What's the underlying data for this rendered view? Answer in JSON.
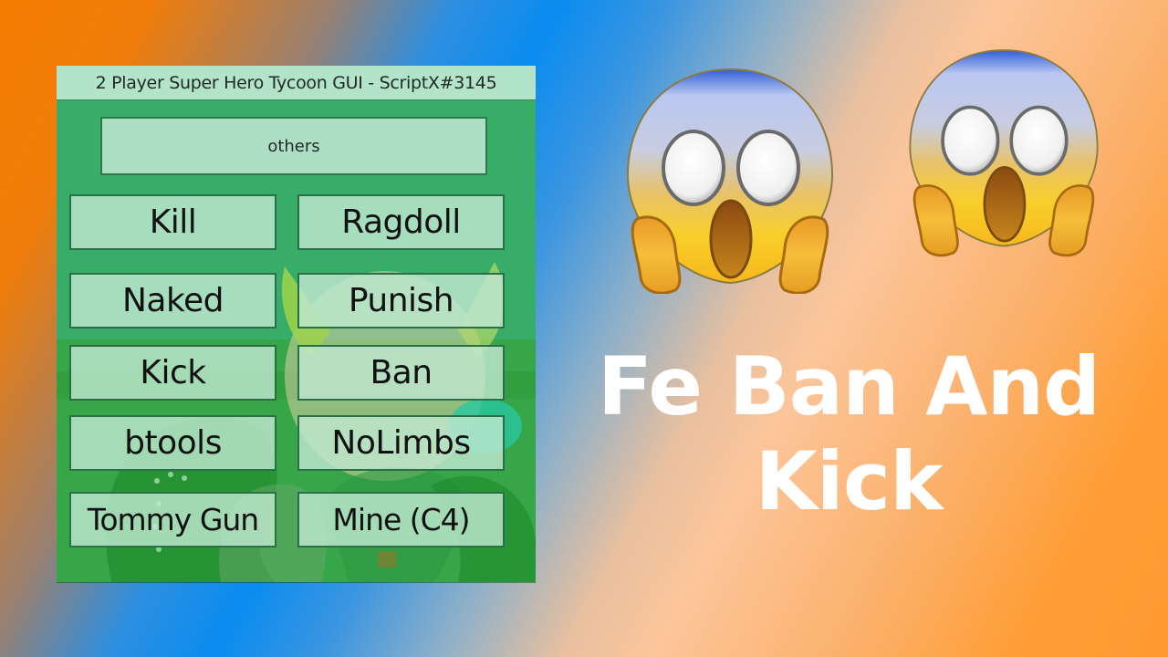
{
  "gui": {
    "title": "2 Player Super Hero Tycoon GUI - ScriptX#3145",
    "tab_button": "others",
    "buttons": [
      {
        "label": "Kill"
      },
      {
        "label": "Ragdoll"
      },
      {
        "label": "Naked"
      },
      {
        "label": "Punish"
      },
      {
        "label": "Kick"
      },
      {
        "label": "Ban"
      },
      {
        "label": "btools"
      },
      {
        "label": "NoLimbs"
      },
      {
        "label": "Tommy Gun"
      },
      {
        "label": "Mine (C4)"
      }
    ],
    "colors": {
      "panel": "#3aae6c",
      "titlebar": "#b3e3c9",
      "button": "#bee8d0",
      "button_border": "#2b6f47"
    }
  },
  "decorations": {
    "emojis": [
      "face-screaming-in-fear",
      "face-screaming-in-fear"
    ]
  },
  "headline": {
    "line1": "Fe Ban And",
    "line2": "Kick",
    "color": "#ffffff"
  }
}
